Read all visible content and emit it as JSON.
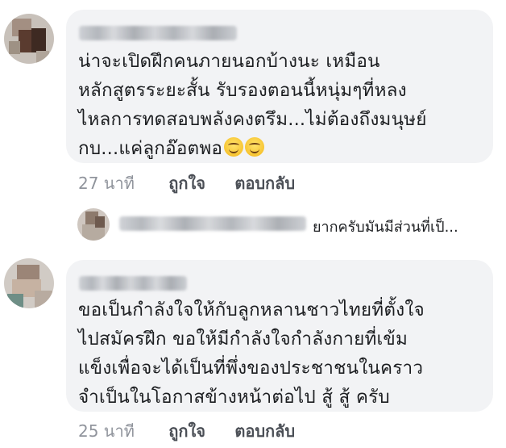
{
  "comments": [
    {
      "text": "น่าจะเปิดฝึกคนภายนอกบ้างนะ เหมือน\nหลักสูตรระยะสั้น รับรองตอนนี้หนุ่มๆที่หลง\nไหลการทดสอบพลังคงตรึม...ไม่ต้องถึงมนุษย์\nกบ...แค่ลูกอ๊อตพอ",
      "emoji_count": 2,
      "time": "27 นาที",
      "like_label": "ถูกใจ",
      "reply_label": "ตอบกลับ"
    },
    {
      "text": "ขอเป็นกำลังใจให้กับลูกหลานชาวไทยที่ตั้งใจ\nไปสมัครฝึก ขอให้มีกำลังใจกำลังกายที่เข้ม\nแข็งเพื่อจะได้เป็นที่พึ่งของประชาชนในคราว\nจำเป็นในโอกาสข้างหน้าต่อไป  สู้ สู้ ครับ",
      "time": "25 นาที",
      "like_label": "ถูกใจ",
      "reply_label": "ตอบกลับ"
    }
  ],
  "reply_preview": {
    "text": "ยากครับมันมีส่วนที่เป็..."
  },
  "colors": {
    "bubble": "#f2f3f5",
    "text": "#1c1e21",
    "meta": "#90949c"
  }
}
